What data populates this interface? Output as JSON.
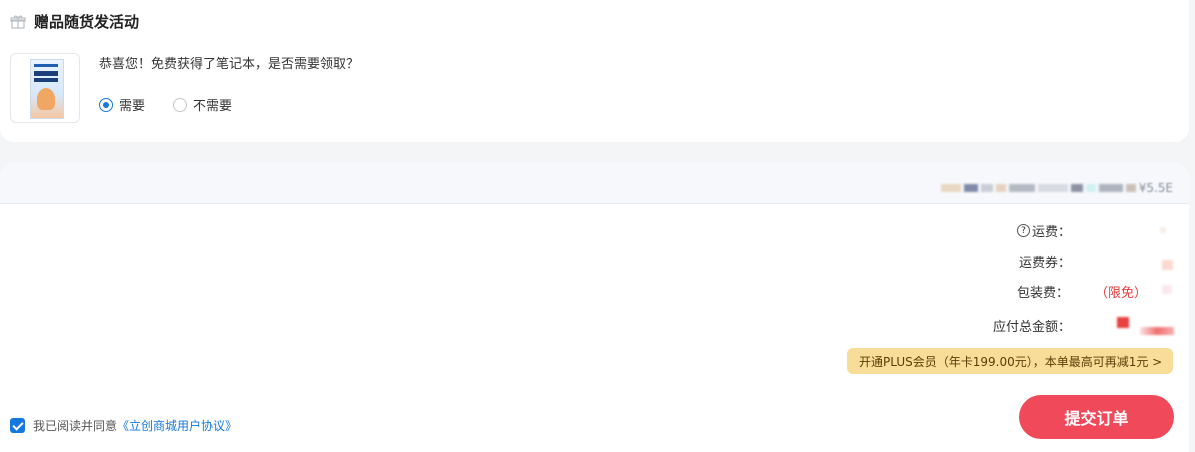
{
  "gift": {
    "title": "赠品随货发活动",
    "question": "恭喜您！免费获得了笔记本，是否需要领取？",
    "options": [
      {
        "label": "需要",
        "checked": true
      },
      {
        "label": "不需要",
        "checked": false
      }
    ]
  },
  "summary": {
    "tail_text": "¥5.5E"
  },
  "fees": {
    "shipping_label": "运费：",
    "shipping_coupon_label": "运费券：",
    "packaging_label": "包装费：",
    "packaging_value": "（限免）",
    "total_label": "应付总金额："
  },
  "plus_offer": {
    "text": "开通PLUS会员（年卡199.00元），本单最高可再减1元 >"
  },
  "agreement": {
    "prefix": "我已阅读并同意",
    "link": "《立创商城用户协议》",
    "checked": true
  },
  "submit_label": "提交订单",
  "colors": {
    "accent_blue": "#1677e0",
    "submit_red": "#f04a5a",
    "plus_gold": "#f8dd98",
    "limited_red": "#e23b3b"
  }
}
